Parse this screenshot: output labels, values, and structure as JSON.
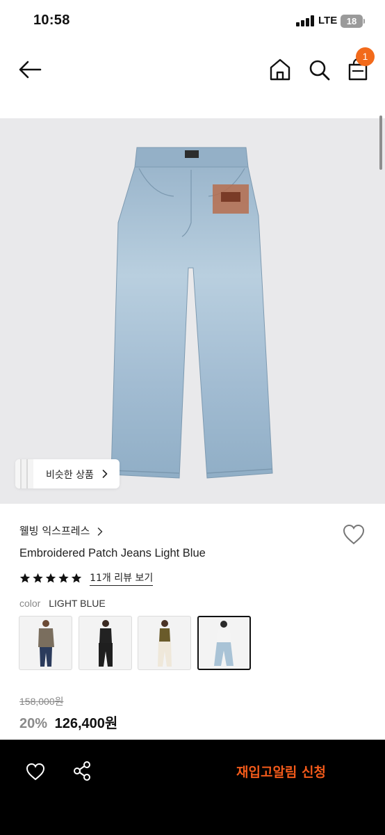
{
  "status_bar": {
    "time": "10:58",
    "network": "LTE",
    "battery": "18"
  },
  "header": {
    "cart_count": "1"
  },
  "image": {
    "similar_label": "비슷한 상품"
  },
  "product": {
    "brand": "웰빙 익스프레스",
    "title": "Embroidered Patch Jeans Light Blue",
    "rating_stars": 5,
    "review_link": "11개 리뷰 보기",
    "color_label": "color",
    "color_value": "LIGHT BLUE",
    "original_price": "158,000원",
    "discount": "20%",
    "sale_price": "126,400원"
  },
  "bottom_bar": {
    "restock_label": "재입고알림 신청"
  },
  "colors": {
    "accent": "#f26a1b",
    "restock": "#f25a1a",
    "denim": "#9db7cc"
  }
}
